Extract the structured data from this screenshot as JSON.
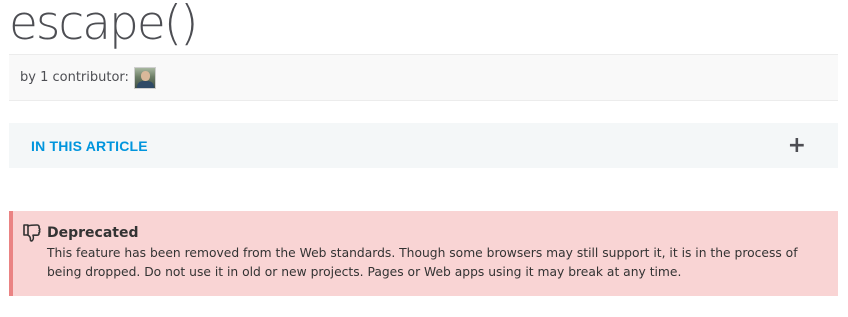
{
  "page": {
    "title": "escape()"
  },
  "contributors": {
    "text": "by 1 contributor:"
  },
  "toc": {
    "label": "IN THIS ARTICLE",
    "toggle": "+"
  },
  "notice": {
    "title": "Deprecated",
    "body": "This feature has been removed from the Web standards. Though some browsers may still support it, it is in the process of being dropped. Do not use it in old or new projects. Pages or Web apps using it may break at any time."
  },
  "colors": {
    "link_accent": "#0095dd",
    "notice_bg": "#f9d4d4",
    "notice_border": "#ea8383",
    "toc_bg": "#f4f7f8"
  },
  "icons": [
    "thumbs-down-icon",
    "plus-icon"
  ]
}
